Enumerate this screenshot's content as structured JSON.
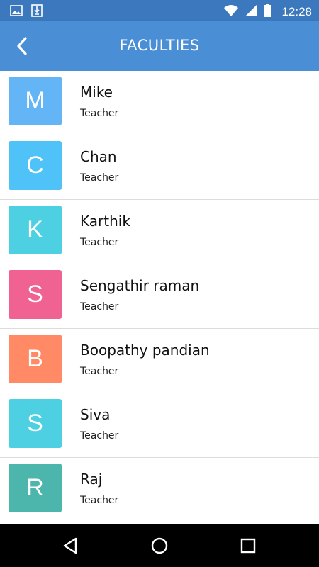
{
  "status_bar": {
    "time": "12:28",
    "icons": [
      "image-icon",
      "download-icon",
      "wifi-icon",
      "signal-icon",
      "battery-icon"
    ]
  },
  "app_bar": {
    "title": "FACULTIES",
    "back_icon": "chevron-left-icon"
  },
  "faculties": [
    {
      "initial": "M",
      "name": "Mike",
      "role": "Teacher",
      "color": "#64b5f6"
    },
    {
      "initial": "C",
      "name": "Chan",
      "role": "Teacher",
      "color": "#4fc3f7"
    },
    {
      "initial": "K",
      "name": "Karthik",
      "role": "Teacher",
      "color": "#4dd0e1"
    },
    {
      "initial": "S",
      "name": "Sengathir raman",
      "role": "Teacher",
      "color": "#f06292"
    },
    {
      "initial": "B",
      "name": "Boopathy pandian",
      "role": "Teacher",
      "color": "#ff8a65"
    },
    {
      "initial": "S",
      "name": "Siva",
      "role": "Teacher",
      "color": "#4dd0e1"
    },
    {
      "initial": "R",
      "name": "Raj",
      "role": "Teacher",
      "color": "#4db6ac"
    }
  ],
  "nav_bar": {
    "icons": [
      "back-triangle-icon",
      "home-circle-icon",
      "recents-square-icon"
    ]
  },
  "colors": {
    "status_bar": "#3b78bd",
    "app_bar": "#4a8fd6"
  }
}
